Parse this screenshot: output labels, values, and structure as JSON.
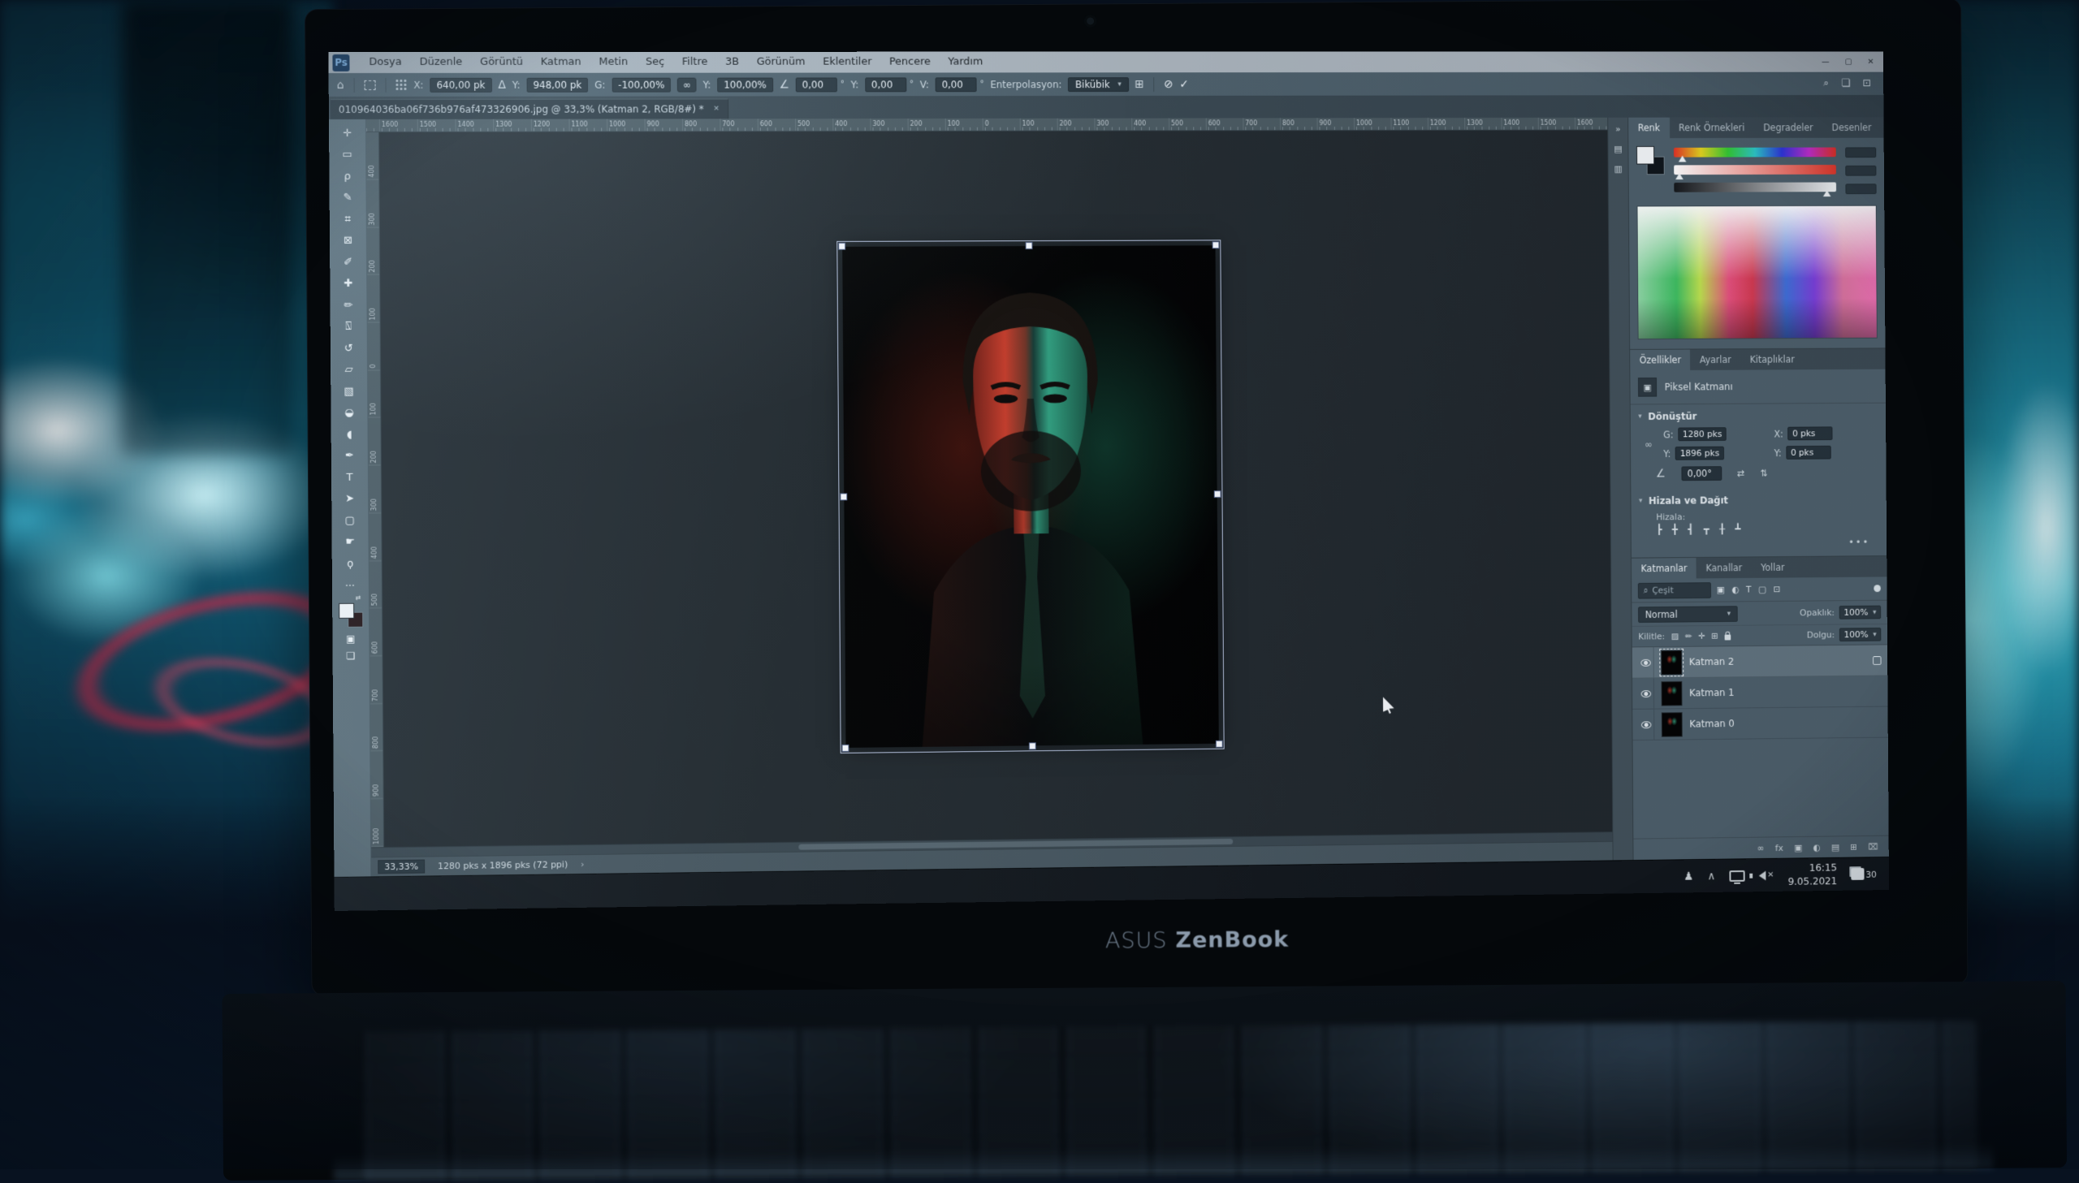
{
  "scene": {
    "brand": "ASUS",
    "model": "ZenBook"
  },
  "menubar": {
    "app_badge": "Ps",
    "items": [
      "Dosya",
      "Düzenle",
      "Görüntü",
      "Katman",
      "Metin",
      "Seç",
      "Filtre",
      "3B",
      "Görünüm",
      "Eklentiler",
      "Pencere",
      "Yardım"
    ],
    "window_controls": [
      "—",
      "▢",
      "✕"
    ]
  },
  "options": {
    "home_glyph": "⌂",
    "x_label": "X:",
    "x_value": "640,00 pk",
    "delta_glyph": "Δ",
    "y_label": "Y:",
    "y_value": "948,00 pk",
    "w_label": "G:",
    "w_value": "-100,00%",
    "link_glyph": "∞",
    "h_label": "Y:",
    "h_value": "100,00%",
    "angle_glyph": "∠",
    "angle_value": "0,00",
    "hskew_label": "Y:",
    "hskew_value": "0,00",
    "vskew_label": "V:",
    "vskew_value": "0,00",
    "degree": "°",
    "interp_label": "Enterpolasyon:",
    "interp_value": "Bikübik",
    "dropdown_caret": "▾",
    "warp_glyph": "⊞",
    "cancel_glyph": "⊘",
    "commit_glyph": "✓",
    "right_icons": [
      "⌕",
      "❏",
      "⊡"
    ]
  },
  "tab": {
    "title": "010964036ba06f736b976af473326906.jpg @ 33,3% (Katman 2, RGB/8#) *",
    "close_glyph": "✕"
  },
  "rulers": {
    "h": [
      "1600",
      "1500",
      "1400",
      "1300",
      "1200",
      "1100",
      "1000",
      "900",
      "800",
      "700",
      "600",
      "500",
      "400",
      "300",
      "200",
      "100",
      "0",
      "100",
      "200",
      "300",
      "400",
      "500",
      "600",
      "700",
      "800",
      "900",
      "1000",
      "1100",
      "1200",
      "1300",
      "1400",
      "1500",
      "1600"
    ],
    "v": [
      "400",
      "300",
      "200",
      "100",
      "0",
      "100",
      "200",
      "300",
      "400",
      "500",
      "600",
      "700",
      "800",
      "900",
      "1000"
    ]
  },
  "toolbar": {
    "tools": [
      {
        "id": "move-tool",
        "glyph": "✛"
      },
      {
        "id": "marquee-tool",
        "glyph": "▭"
      },
      {
        "id": "lasso-tool",
        "glyph": "ρ"
      },
      {
        "id": "quick-selection-tool",
        "glyph": "✎"
      },
      {
        "id": "crop-tool",
        "glyph": "⌗"
      },
      {
        "id": "frame-tool",
        "glyph": "⊠"
      },
      {
        "id": "eyedropper-tool",
        "glyph": "✐"
      },
      {
        "id": "healing-brush-tool",
        "glyph": "✚"
      },
      {
        "id": "brush-tool",
        "glyph": "✏"
      },
      {
        "id": "clone-stamp-tool",
        "glyph": "⍂"
      },
      {
        "id": "history-brush-tool",
        "glyph": "↺"
      },
      {
        "id": "eraser-tool",
        "glyph": "▱"
      },
      {
        "id": "gradient-tool",
        "glyph": "▧"
      },
      {
        "id": "blur-tool",
        "glyph": "◒"
      },
      {
        "id": "dodge-tool",
        "glyph": "◖"
      },
      {
        "id": "pen-tool",
        "glyph": "✒"
      },
      {
        "id": "type-tool",
        "glyph": "T"
      },
      {
        "id": "path-selection-tool",
        "glyph": "➤"
      },
      {
        "id": "rectangle-tool",
        "glyph": "▢"
      },
      {
        "id": "hand-tool",
        "glyph": "☛"
      },
      {
        "id": "zoom-tool",
        "glyph": "ϙ"
      }
    ],
    "more_glyph": "…",
    "swap_glyph": "⇄",
    "quick_mask_glyph": "▣",
    "screen_mode_glyph": "❏"
  },
  "panels": {
    "dock_icons": [
      {
        "id": "collapse-panels-icon",
        "glyph": "»"
      },
      {
        "id": "history-panel-icon",
        "glyph": "▤"
      },
      {
        "id": "info-panel-icon",
        "glyph": "▥"
      }
    ],
    "color": {
      "tabs": [
        "Renk",
        "Renk Örnekleri",
        "Degradeler",
        "Desenler"
      ]
    },
    "properties": {
      "tabs": [
        "Özellikler",
        "Ayarlar",
        "Kitaplıklar"
      ],
      "layer_type": "Piksel Katmanı",
      "thumb_glyph": "▣",
      "caret": "▾",
      "transform_title": "Dönüştür",
      "link_glyph": "∞",
      "w_label": "G:",
      "w_value": "1280 pks",
      "x_label": "X:",
      "x_value": "0 pks",
      "h_label": "Y:",
      "h_value": "1896 pks",
      "y_label": "Y:",
      "y_value": "0 pks",
      "angle_glyph": "∠",
      "angle_value": "0,00°",
      "flip_h_glyph": "⇄",
      "flip_v_glyph": "⇅",
      "align_title": "Hizala ve Dağıt",
      "align_label": "Hizala:",
      "align_icons": [
        "┣",
        "╋",
        "┫",
        "┳",
        "╂",
        "┻"
      ],
      "more": "•••"
    },
    "layers": {
      "tabs": [
        "Katmanlar",
        "Kanallar",
        "Yollar"
      ],
      "search_glyph": "⌕",
      "filter_label": "Çeşit",
      "filter_icons": [
        {
          "id": "filter-pixel-layers-icon",
          "glyph": "▣"
        },
        {
          "id": "filter-adjustment-layers-icon",
          "glyph": "◐"
        },
        {
          "id": "filter-type-layers-icon",
          "glyph": "T"
        },
        {
          "id": "filter-shape-layers-icon",
          "glyph": "▢"
        },
        {
          "id": "filter-smart-objects-icon",
          "glyph": "⊡"
        }
      ],
      "blend_mode": "Normal",
      "opacity_label": "Opaklık:",
      "opacity_value": "100%",
      "lock_label": "Kilitle:",
      "lock_icons": [
        {
          "id": "lock-transparent-icon",
          "glyph": "▨"
        },
        {
          "id": "lock-pixels-icon",
          "glyph": "✏"
        },
        {
          "id": "lock-position-icon",
          "glyph": "✛"
        },
        {
          "id": "lock-artboard-icon",
          "glyph": "⊞"
        }
      ],
      "fill_label": "Dolgu:",
      "fill_value": "100%",
      "items": [
        {
          "label": "Katman 2",
          "cls": "selected"
        },
        {
          "label": "Katman 1"
        },
        {
          "label": "Katman 0"
        }
      ],
      "footer_icons": [
        {
          "id": "link-layers-icon",
          "glyph": "∞"
        },
        {
          "id": "layer-effects-icon",
          "glyph": "fx"
        },
        {
          "id": "add-mask-icon",
          "glyph": "▣"
        },
        {
          "id": "adjustment-layer-icon",
          "glyph": "◐"
        },
        {
          "id": "layer-group-icon",
          "glyph": "▤"
        },
        {
          "id": "new-layer-icon",
          "glyph": "⊞"
        },
        {
          "id": "delete-layer-icon",
          "glyph": "⌧"
        }
      ]
    }
  },
  "statusbar": {
    "zoom": "33,33%",
    "doc_info": "1280 pks x 1896 pks (72 ppi)",
    "chevron": "›"
  },
  "taskbar": {
    "people_glyph": "♟",
    "tray_collapse_glyph": "∧",
    "time": "16:15",
    "date": "9.05.2021",
    "notification_count": "30"
  },
  "colors": {
    "portrait_red": "#c43a28",
    "portrait_teal": "#2f9d7d",
    "ps_badge_bg": "#0b2c52",
    "ps_badge_text": "#7fb5e8",
    "selection_box": "#c3d0ee"
  }
}
